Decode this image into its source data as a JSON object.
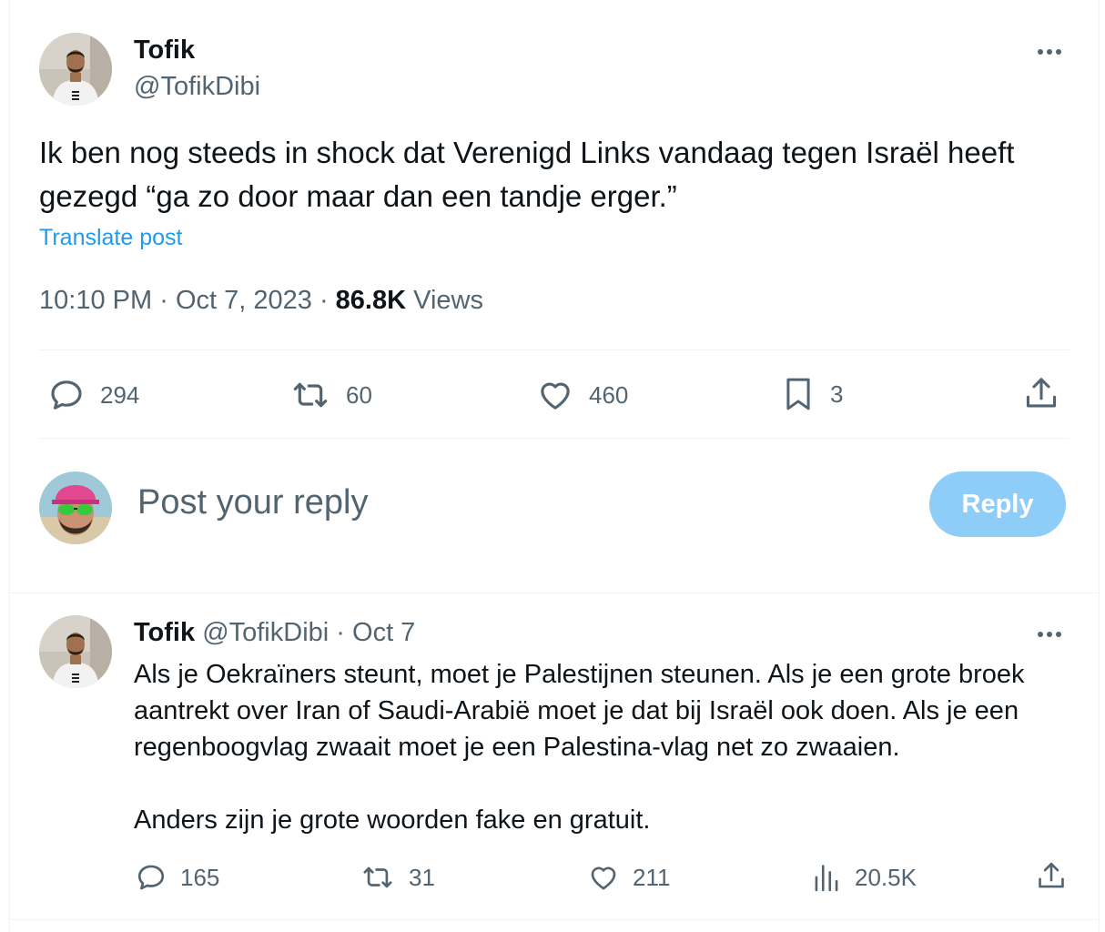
{
  "tweet": {
    "author_name": "Tofik",
    "author_handle": "@TofikDibi",
    "text": "Ik ben nog steeds in shock dat Verenigd Links vandaag tegen Israël heeft gezegd “ga zo door maar dan een tandje erger.”",
    "translate_label": "Translate post",
    "time": "10:10 PM",
    "date": "Oct 7, 2023",
    "views_count": "86.8K",
    "views_label": "Views",
    "separator": "·",
    "actions": {
      "replies": "294",
      "reposts": "60",
      "likes": "460",
      "bookmarks": "3"
    }
  },
  "reply_box": {
    "placeholder": "Post your reply",
    "button_label": "Reply"
  },
  "reply_tweet": {
    "author_name": "Tofik",
    "author_handle": "@TofikDibi",
    "date": "Oct 7",
    "separator": "·",
    "paragraph1": "Als je Oekraïners steunt, moet je Palestijnen steunen. Als je een grote broek aantrekt over Iran of Saudi-Arabië moet je dat bij Israël ook doen. Als je een regenboogvlag zwaait moet je een Palestina-vlag net zo zwaaien.",
    "paragraph2": "Anders zijn je grote woorden fake en gratuit.",
    "actions": {
      "replies": "165",
      "reposts": "31",
      "likes": "211",
      "views": "20.5K"
    }
  },
  "colors": {
    "accent": "#1d9bf0",
    "reply_button": "#8ecdf8",
    "secondary_text": "#536471",
    "divider": "#eff3f4"
  },
  "icons": {
    "reply": "speech-bubble-icon",
    "repost": "repost-arrows-icon",
    "like": "heart-icon",
    "bookmark": "bookmark-icon",
    "share": "share-upload-icon",
    "views": "bar-chart-icon",
    "more": "ellipsis-icon"
  }
}
